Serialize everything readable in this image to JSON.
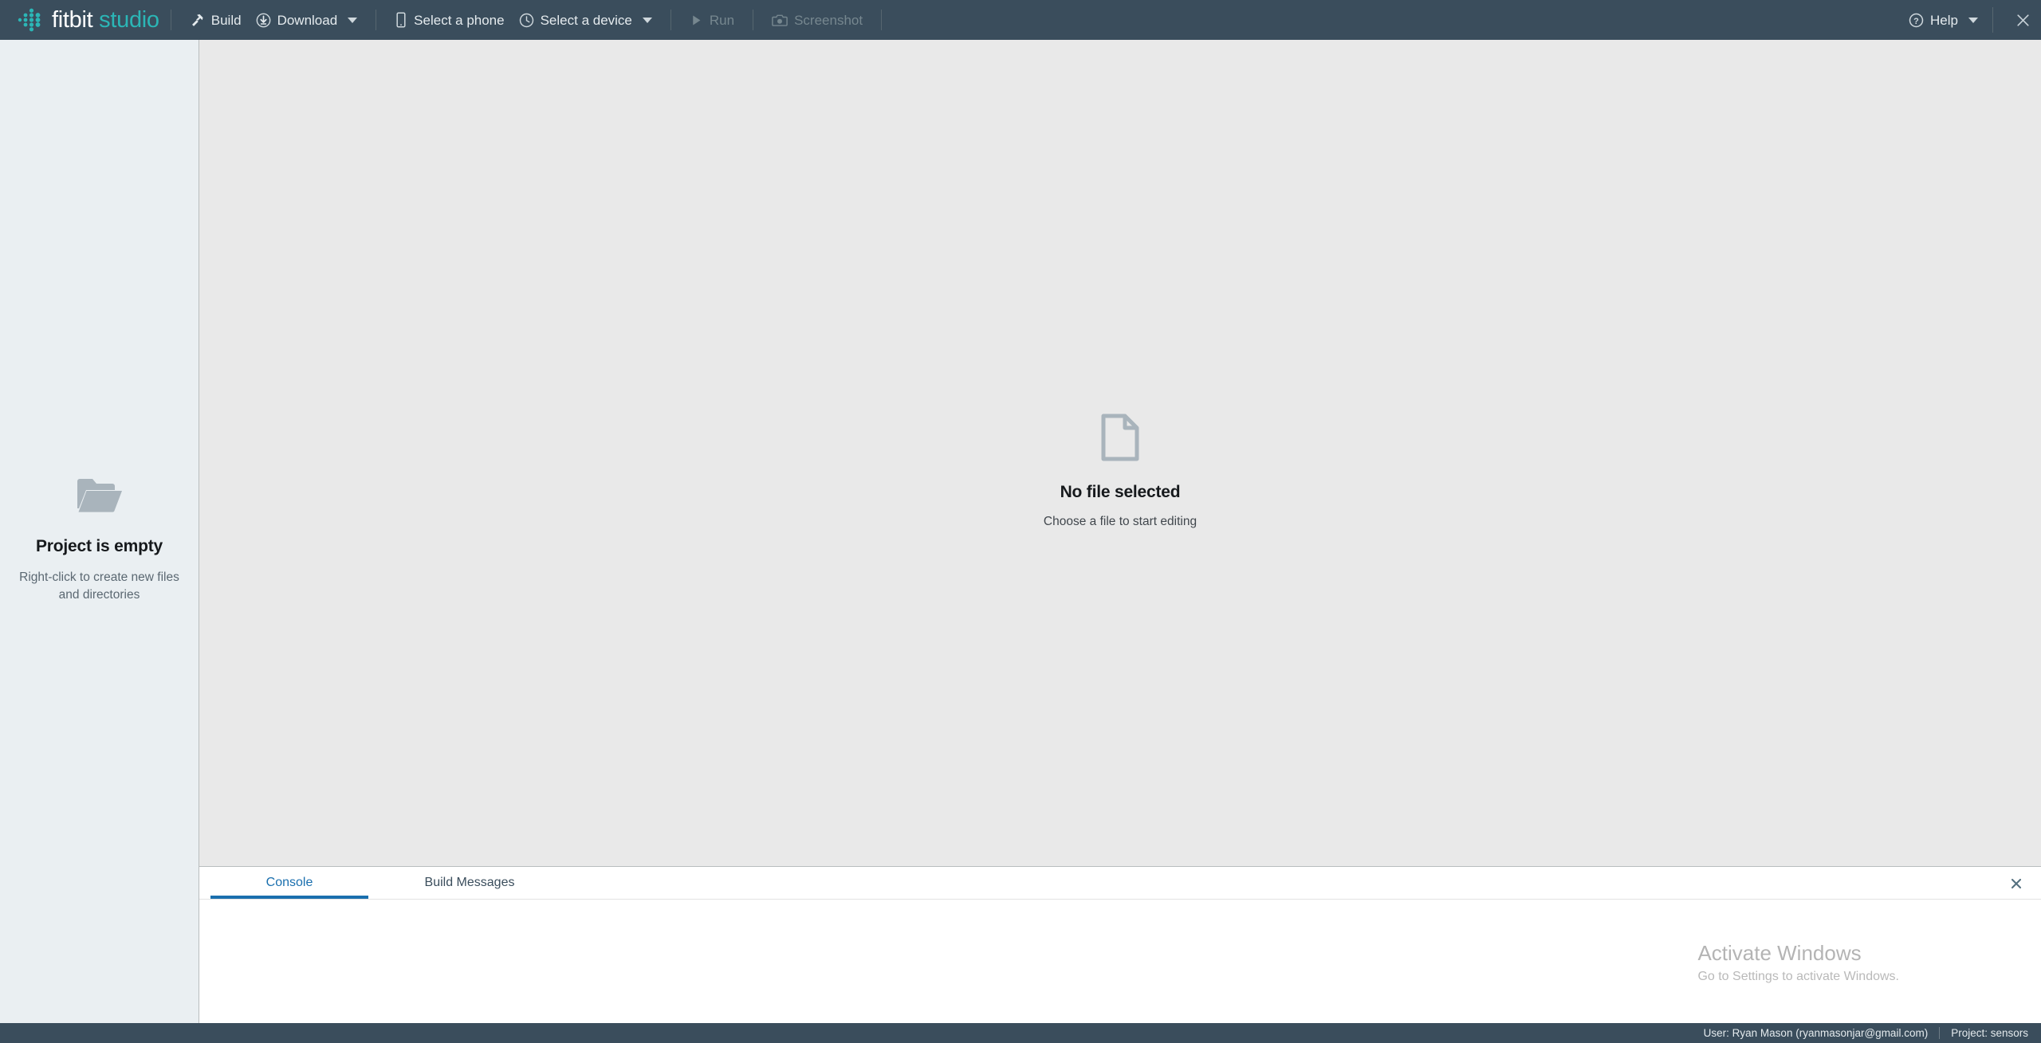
{
  "app": {
    "logo_primary": "fitbit",
    "logo_secondary": "studio",
    "logo_icon": "fitbit-dots-logo"
  },
  "toolbar": {
    "build": {
      "label": "Build",
      "icon": "hammer-icon",
      "enabled": true
    },
    "download": {
      "label": "Download",
      "icon": "download-circle-icon",
      "enabled": true,
      "has_caret": true
    },
    "select_phone": {
      "label": "Select a phone",
      "icon": "phone-icon",
      "enabled": true
    },
    "select_device": {
      "label": "Select a device",
      "icon": "watch-clock-icon",
      "enabled": true,
      "has_caret": true
    },
    "run": {
      "label": "Run",
      "icon": "play-icon",
      "enabled": false
    },
    "screenshot": {
      "label": "Screenshot",
      "icon": "camera-icon",
      "enabled": false
    },
    "help": {
      "label": "Help",
      "icon": "question-circle-icon",
      "enabled": true,
      "has_caret": true
    },
    "close": {
      "icon": "close-icon",
      "label": ""
    }
  },
  "sidebar": {
    "icon": "open-folder-icon",
    "title": "Project is empty",
    "subtitle": "Right-click to create new files and directories"
  },
  "editor": {
    "icon": "file-page-icon",
    "title": "No file selected",
    "subtitle": "Choose a file to start editing"
  },
  "console": {
    "tabs": [
      {
        "label": "Console",
        "active": true
      },
      {
        "label": "Build Messages",
        "active": false
      }
    ],
    "close_icon": "close-icon",
    "content": ""
  },
  "watermark": {
    "title": "Activate Windows",
    "subtitle": "Go to Settings to activate Windows."
  },
  "statusbar": {
    "user": "User: Ryan Mason (ryanmasonjar@gmail.com)",
    "project": "Project: sensors"
  },
  "colors": {
    "toolbar_bg": "#3a4d5c",
    "sidebar_bg": "#eaeff2",
    "editor_bg": "#e9e9e9",
    "console_bg": "#ffffff",
    "accent_teal": "#2bb6b6",
    "accent_blue": "#1a6fae",
    "icon_gray": "#a9b4bc"
  }
}
